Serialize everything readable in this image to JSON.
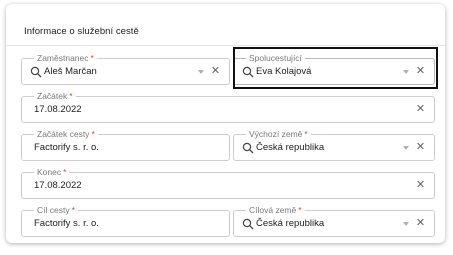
{
  "card": {
    "title": "Informace o služební cestě"
  },
  "fields": {
    "employee": {
      "label": "Zaměstnanec",
      "required": "*",
      "value": "Aleš Marčan"
    },
    "companions": {
      "label": "Spolucestující",
      "value": "Eva Kolajová"
    },
    "start": {
      "label": "Začátek",
      "required": "*",
      "value": "17.08.2022"
    },
    "trip_start": {
      "label": "Začátek cesty",
      "required": "*",
      "value": "Factorify s. r. o."
    },
    "origin_country": {
      "label": "Výchozí země",
      "required": "*",
      "value": "Česká republika"
    },
    "end": {
      "label": "Konec",
      "required": "*",
      "value": "17.08.2022"
    },
    "destination": {
      "label": "Cíl cesty",
      "required": "*",
      "value": "Factorify s. r. o."
    },
    "destination_country": {
      "label": "Cílová země",
      "required": "*",
      "value": "Česká republika"
    }
  },
  "icons": {
    "search": "search-icon",
    "clear": "close-icon",
    "dropdown": "caret-down-icon"
  },
  "colors": {
    "required": "#e53935",
    "text": "#212121",
    "label": "#7a7a7a",
    "border": "#cdcdcd",
    "highlight": "#111111"
  }
}
